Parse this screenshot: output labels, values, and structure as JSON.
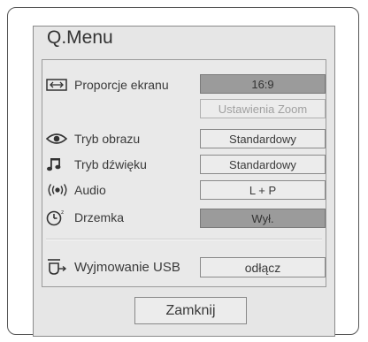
{
  "menu": {
    "title": "Q.Menu",
    "items": [
      {
        "icon": "aspect-ratio-icon",
        "label": "Proporcje ekranu",
        "value": "16:9",
        "state": "selected"
      },
      {
        "icon": "",
        "label": "",
        "value": "Ustawienia Zoom",
        "state": "disabled"
      },
      {
        "icon": "eye-icon",
        "label": "Tryb obrazu",
        "value": "Standardowy",
        "state": "normal"
      },
      {
        "icon": "music-note-icon",
        "label": "Tryb dźwięku",
        "value": "Standardowy",
        "state": "normal"
      },
      {
        "icon": "audio-signal-icon",
        "label": "Audio",
        "value": "L + P",
        "state": "normal"
      },
      {
        "icon": "sleep-clock-icon",
        "label": "Drzemka",
        "value": "Wył.",
        "state": "selected"
      }
    ],
    "usb": {
      "icon": "usb-eject-icon",
      "label": "Wyjmowanie USB",
      "value": "odłącz"
    },
    "close_label": "Zamknij"
  }
}
